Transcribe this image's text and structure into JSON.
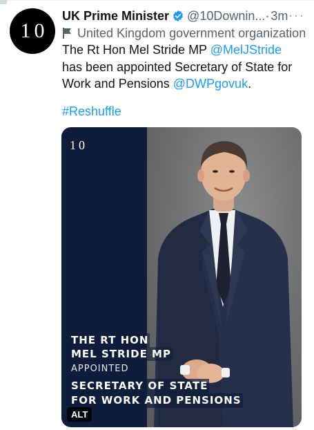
{
  "tweet": {
    "avatar_text": "10",
    "display_name": "UK Prime Minister",
    "handle": "@10Downin...",
    "separator": " · ",
    "time": "3m",
    "more": "···",
    "affiliation": "United Kingdom government organization",
    "text_part1": "The Rt Hon Mel Stride MP ",
    "mention1": "@MelJStride",
    "text_part2": " has been appointed Secretary of State for Work and Pensions ",
    "mention2": "@DWPgovuk",
    "text_part3": ".",
    "hashtag": "#Reshuffle"
  },
  "media": {
    "logo": "10",
    "caption_line1": "THE RT HON",
    "caption_line2": "MEL STRIDE MP",
    "appointed": "APPOINTED",
    "role_line1": "SECRETARY OF STATE",
    "role_line2": "FOR WORK AND PENSIONS",
    "alt_badge": "ALT"
  },
  "icons": {
    "verified": "verified-badge-icon",
    "affiliation": "flag-icon",
    "more": "more-icon"
  },
  "colors": {
    "link": "#1d9bf0",
    "muted": "#536471",
    "navy_panel": "#0f1c3a"
  }
}
